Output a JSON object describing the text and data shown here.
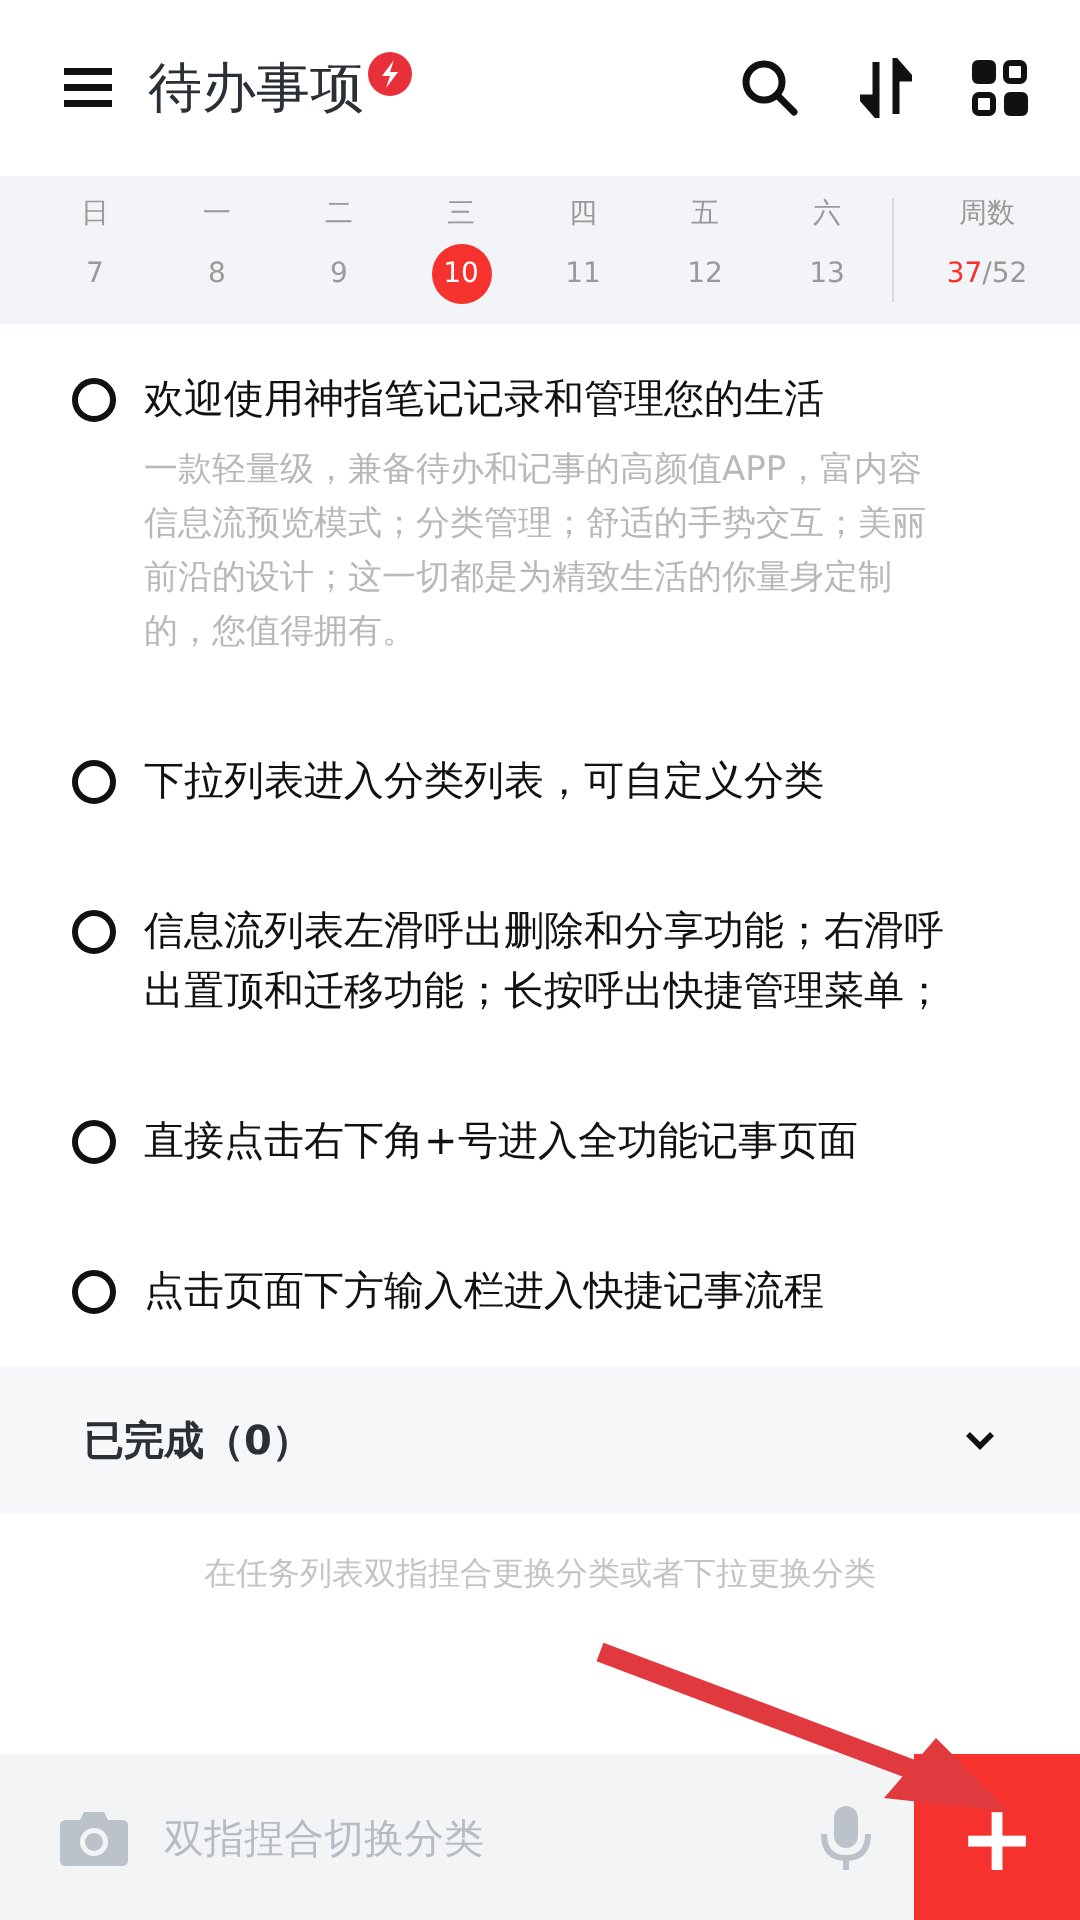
{
  "header": {
    "title": "待办事项"
  },
  "calendar": {
    "days": [
      {
        "weekday": "日",
        "date": "7",
        "selected": false
      },
      {
        "weekday": "一",
        "date": "8",
        "selected": false
      },
      {
        "weekday": "二",
        "date": "9",
        "selected": false
      },
      {
        "weekday": "三",
        "date": "10",
        "selected": true
      },
      {
        "weekday": "四",
        "date": "11",
        "selected": false
      },
      {
        "weekday": "五",
        "date": "12",
        "selected": false
      },
      {
        "weekday": "六",
        "date": "13",
        "selected": false
      }
    ],
    "week": {
      "label": "周数",
      "current": "37",
      "total": "/52"
    }
  },
  "tasks": [
    {
      "title": "欢迎使用神指笔记记录和管理您的生活",
      "note": "一款轻量级，兼备待办和记事的高颜值APP，富内容信息流预览模式；分类管理；舒适的手势交互；美丽前沿的设计；这一切都是为精致生活的你量身定制的，您值得拥有。",
      "checked": false
    },
    {
      "title": "下拉列表进入分类列表，可自定义分类",
      "checked": false
    },
    {
      "title": "信息流列表左滑呼出删除和分享功能；右滑呼出置顶和迁移功能；长按呼出快捷管理菜单；",
      "checked": false
    },
    {
      "title": "直接点击右下角+号进入全功能记事页面",
      "checked": false
    },
    {
      "title": "点击页面下方输入栏进入快捷记事流程",
      "checked": false
    }
  ],
  "completed": {
    "label": "已完成（0）",
    "expanded": false
  },
  "hint": "在任务列表双指捏合更换分类或者下拉更换分类",
  "input": {
    "placeholder": "双指捏合切换分类"
  },
  "add_button": {
    "label": "+"
  }
}
